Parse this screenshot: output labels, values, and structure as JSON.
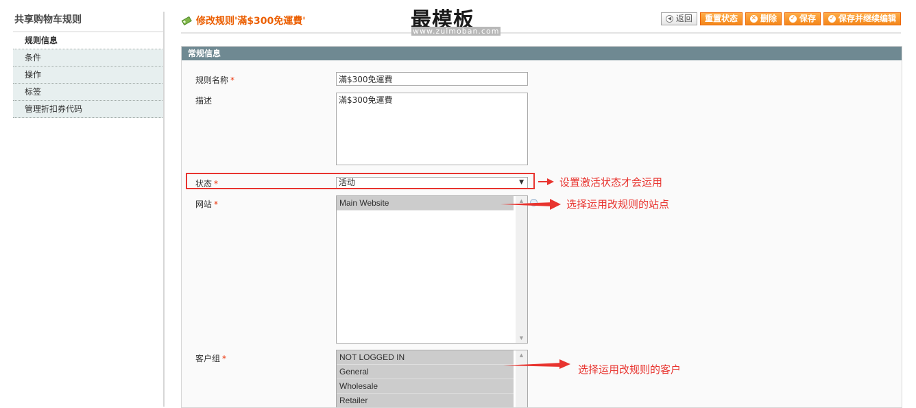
{
  "sidebar": {
    "title": "共享购物车规则",
    "items": [
      {
        "label": "规则信息"
      },
      {
        "label": "条件"
      },
      {
        "label": "操作"
      },
      {
        "label": "标签"
      },
      {
        "label": "管理折扣券代码"
      }
    ]
  },
  "header": {
    "title": "修改规则'滿$300免運費'",
    "watermark": "最模板",
    "watermark_url": "www.zuimoban.com",
    "buttons": {
      "back": "返回",
      "reset": "重置状态",
      "delete": "删除",
      "save": "保存",
      "save_continue": "保存并继续编辑"
    }
  },
  "section": {
    "title": "常规信息",
    "fields": {
      "rule_name": {
        "label": "规则名称",
        "value": "滿$300免運費"
      },
      "description": {
        "label": "描述",
        "value": "滿$300免運費"
      },
      "status": {
        "label": "状态",
        "value": "活动"
      },
      "website": {
        "label": "网站",
        "options": [
          "Main Website"
        ]
      },
      "customer_group": {
        "label": "客户组",
        "options": [
          "NOT LOGGED IN",
          "General",
          "Wholesale",
          "Retailer"
        ]
      }
    },
    "required_mark": "*"
  },
  "annotations": {
    "status_note": "设置激活状态才会运用",
    "website_note": "选择运用改规则的站点",
    "customer_note": "选择运用改规则的客户"
  },
  "colors": {
    "accent": "#eb5e00",
    "button": "#f3861b",
    "section_header": "#6f8992",
    "annotation": "#e8342f"
  }
}
